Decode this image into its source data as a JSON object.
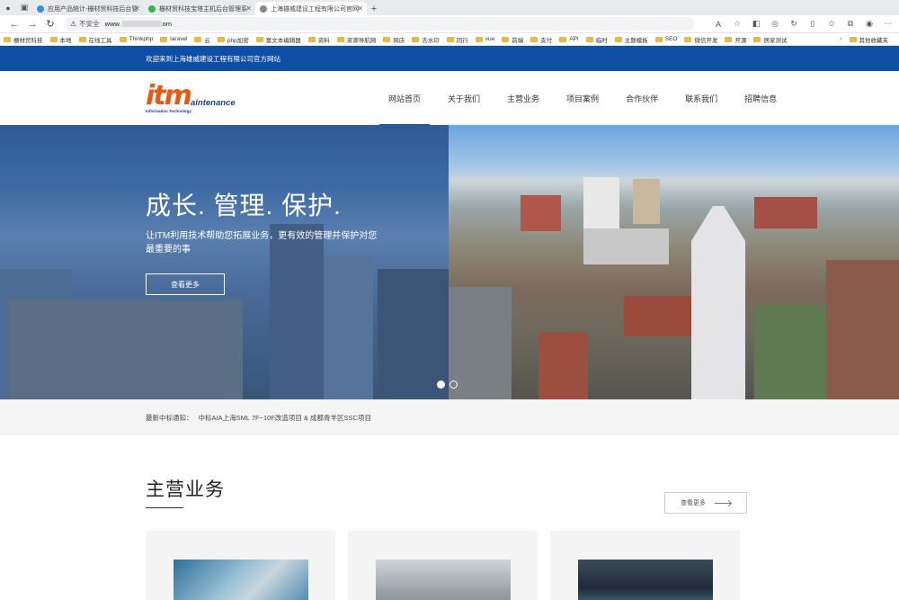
{
  "browser": {
    "tabs": [
      {
        "title": "应用产品统计-栅材贸科技后台管",
        "active": false,
        "fav": "#3c8ddc"
      },
      {
        "title": "栅材贸科技宝塔主机后台管理系",
        "active": false,
        "fav": "#39b54a"
      },
      {
        "title": "上海雄威建设工程有限公司官网",
        "active": true,
        "fav": "#888888"
      }
    ],
    "address": {
      "warning": "不安全",
      "url_prefix": "www.",
      "url_suffix": "om"
    },
    "bookmarks": [
      "栅材贸科技",
      "本地",
      "在线工具",
      "Thinkphp",
      "laravel",
      "云",
      "php加密",
      "富文本编辑器",
      "资料",
      "资源导航网",
      "网店",
      "去水印",
      "同行",
      "vue",
      "前端",
      "支付",
      "API",
      "临时",
      "主题模板",
      "SEO",
      "微信开发",
      "开源",
      "居家测试"
    ],
    "bookmarks_more": "其他收藏夹"
  },
  "site": {
    "welcome": "欢迎来到上海雄威建设工程有限公司官方网站",
    "logo": {
      "main": "itm",
      "tail": "aintenance",
      "sub": "Information Technology"
    },
    "nav": [
      "网站首页",
      "关于我们",
      "主营业务",
      "项目案例",
      "合作伙伴",
      "联系我们",
      "招聘信息"
    ],
    "hero": {
      "title": "成长. 管理. 保护.",
      "text": "让ITM利用技术帮助您拓展业务，更有效的管理并保护对您最重要的事",
      "button": "查看更多"
    },
    "notice": {
      "label": "最新中标通知：",
      "text": "中标AIA上海SML 7F~10F改造项目 & 成都青羊区SSC项目"
    },
    "section": {
      "title": "主营业务",
      "more": "查看更多"
    }
  },
  "colors": {
    "brand_blue": "#0e4fa5",
    "logo_orange": "#e85a13"
  }
}
